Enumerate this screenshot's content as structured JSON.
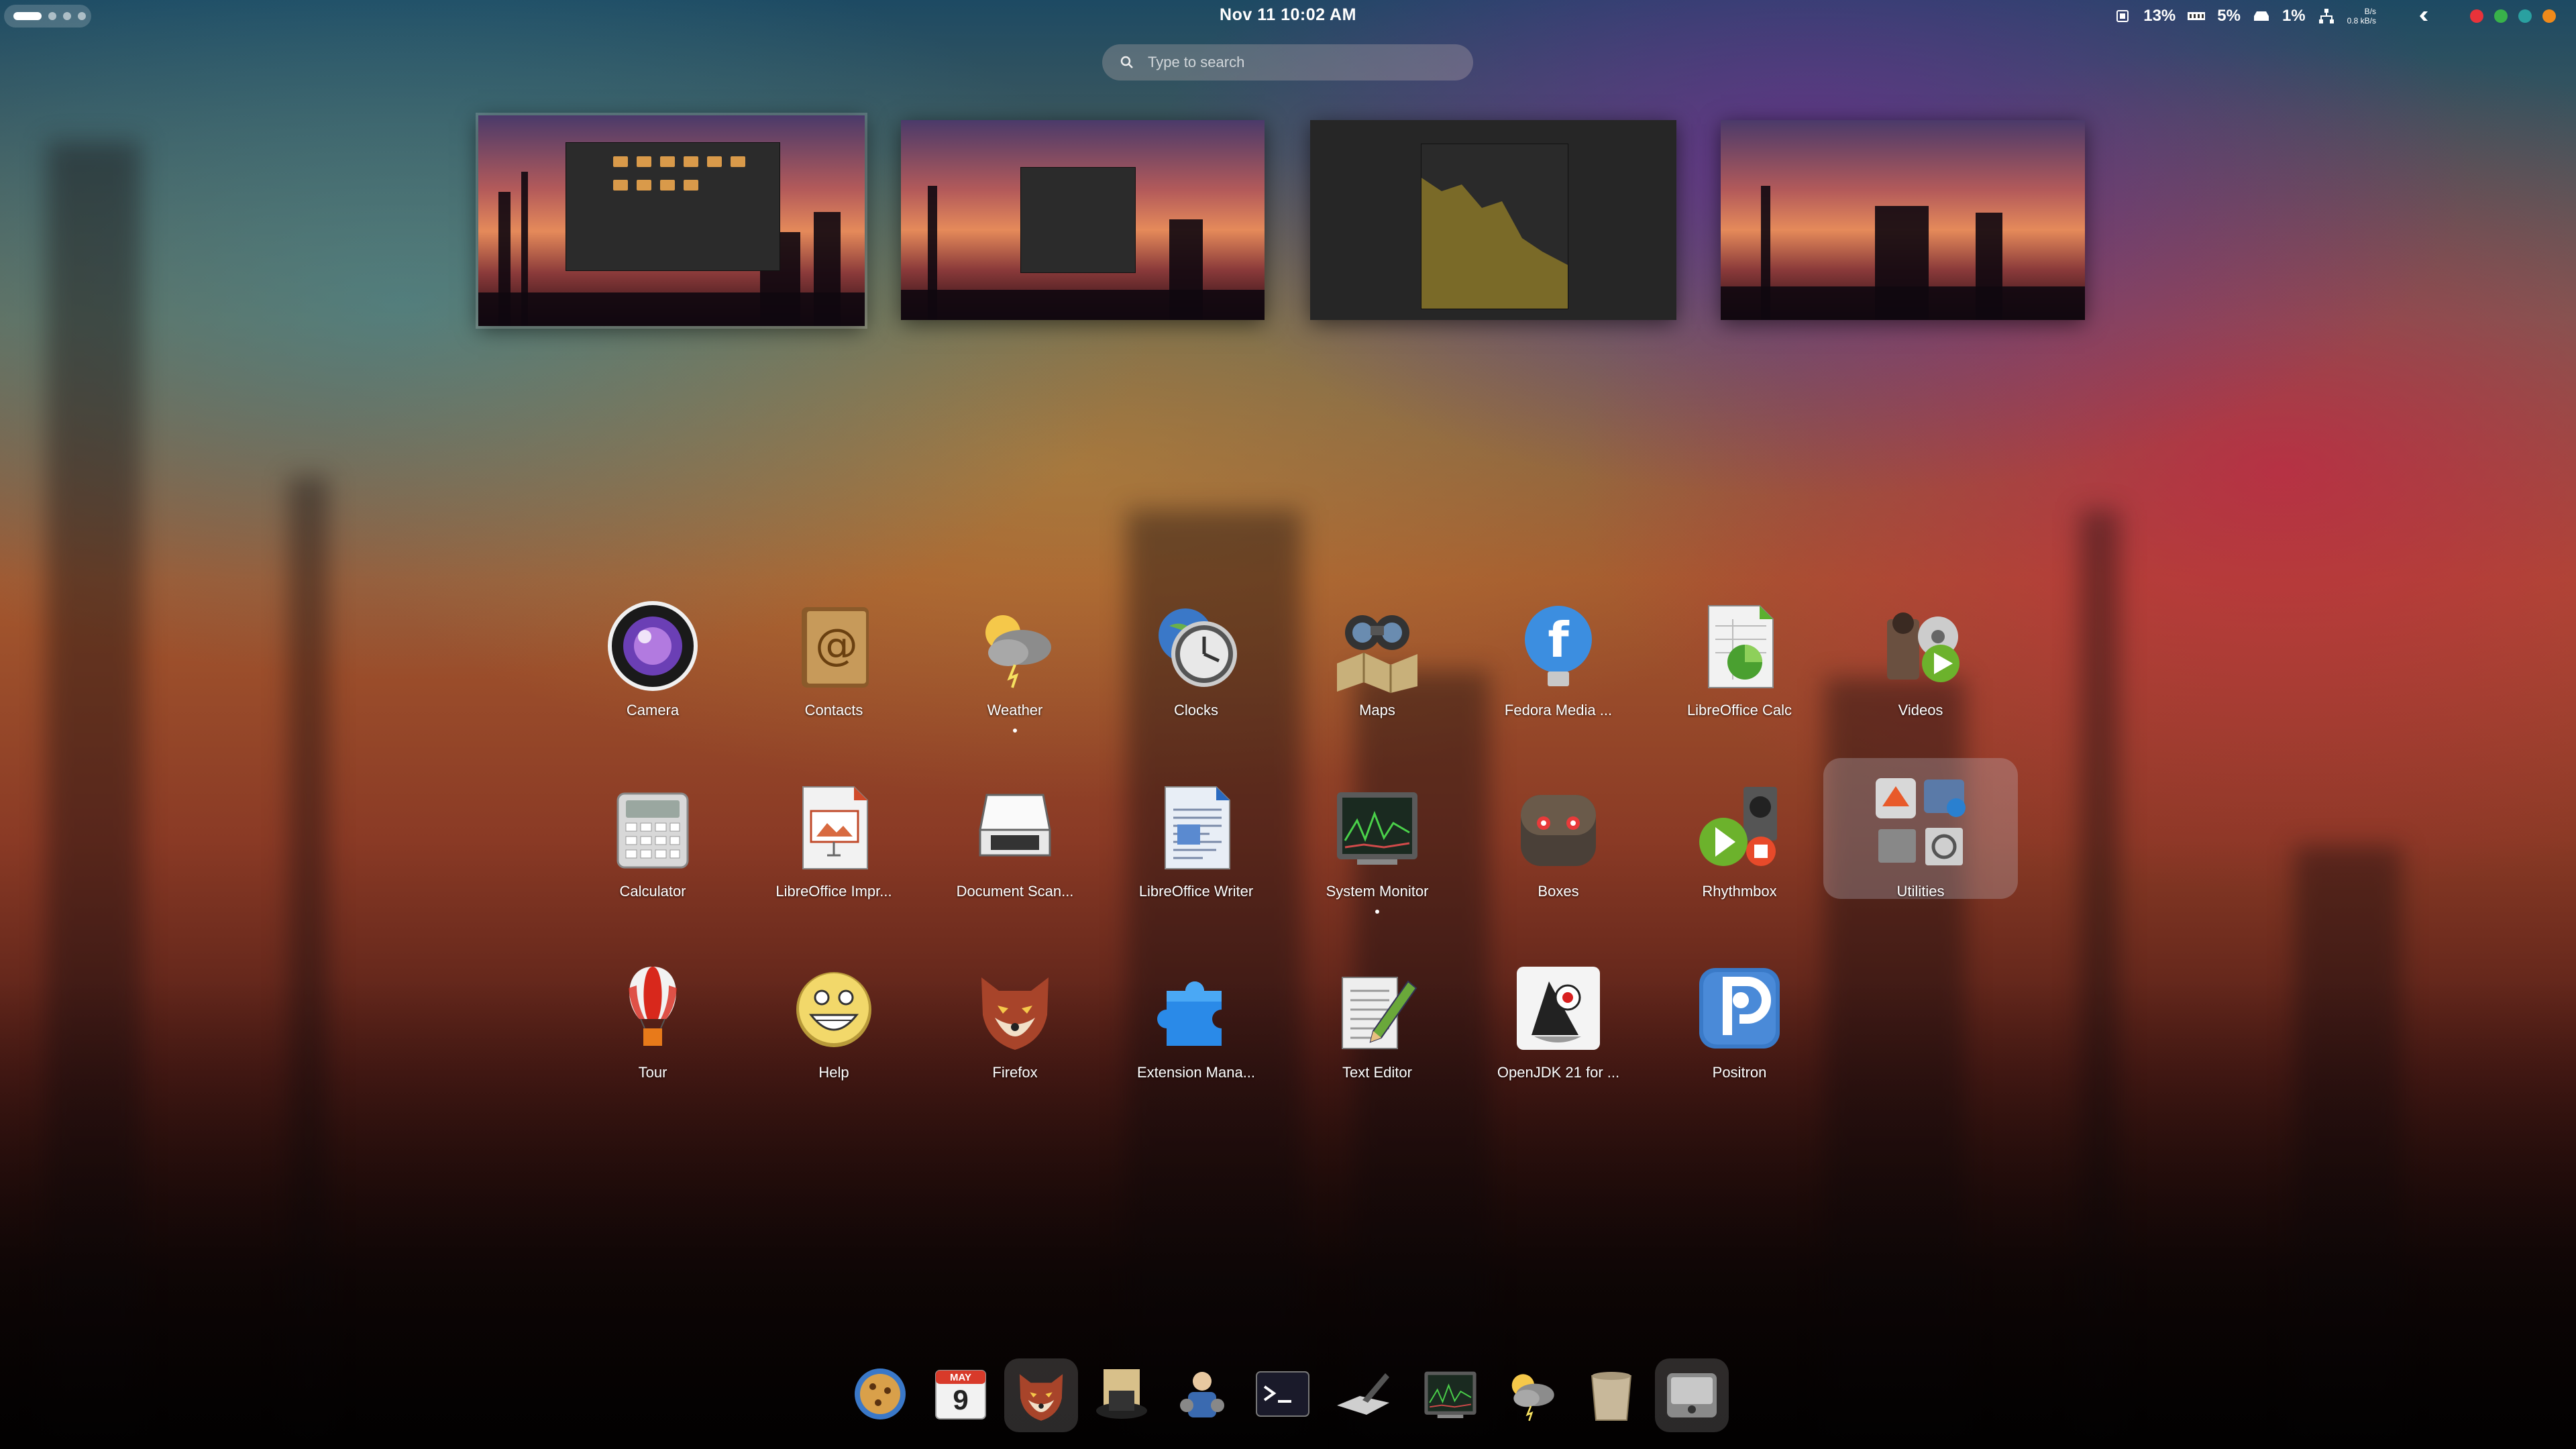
{
  "topbar": {
    "clock": "Nov 11  10:02 AM",
    "cpu": "13%",
    "memory": "5%",
    "disk": "1%",
    "net_up": "B/s",
    "net_down": "0.8 kB/s",
    "icons": [
      "cpu-icon",
      "memory-icon",
      "drive-icon",
      "network-icon",
      "system-icon",
      "red-app-icon",
      "green-app-icon",
      "teal-app-icon",
      "orange-app-icon"
    ]
  },
  "search": {
    "placeholder": "Type to search"
  },
  "workspaces": [
    {
      "content": "file-manager"
    },
    {
      "content": "settings-window"
    },
    {
      "content": "system-monitor-chart"
    },
    {
      "content": "empty"
    }
  ],
  "apps": [
    {
      "label": "Camera",
      "icon": "camera-icon"
    },
    {
      "label": "Contacts",
      "icon": "contacts-icon"
    },
    {
      "label": "Weather",
      "icon": "weather-icon",
      "running": true
    },
    {
      "label": "Clocks",
      "icon": "clocks-icon"
    },
    {
      "label": "Maps",
      "icon": "maps-icon"
    },
    {
      "label": "Fedora Media ...",
      "icon": "fedora-media-writer-icon"
    },
    {
      "label": "LibreOffice Calc",
      "icon": "libreoffice-calc-icon"
    },
    {
      "label": "Videos",
      "icon": "videos-icon"
    },
    {
      "label": "Calculator",
      "icon": "calculator-icon"
    },
    {
      "label": "LibreOffice Impr...",
      "icon": "libreoffice-impress-icon"
    },
    {
      "label": "Document Scan...",
      "icon": "document-scanner-icon"
    },
    {
      "label": "LibreOffice Writer",
      "icon": "libreoffice-writer-icon"
    },
    {
      "label": "System Monitor",
      "icon": "system-monitor-icon",
      "running": true
    },
    {
      "label": "Boxes",
      "icon": "boxes-icon"
    },
    {
      "label": "Rhythmbox",
      "icon": "rhythmbox-icon"
    },
    {
      "label": "Utilities",
      "icon": "utilities-folder-icon"
    },
    {
      "label": "Tour",
      "icon": "tour-icon"
    },
    {
      "label": "Help",
      "icon": "help-icon"
    },
    {
      "label": "Firefox",
      "icon": "firefox-icon"
    },
    {
      "label": "Extension Mana...",
      "icon": "extension-manager-icon"
    },
    {
      "label": "Text Editor",
      "icon": "text-editor-icon"
    },
    {
      "label": "OpenJDK 21 for ...",
      "icon": "openjdk-icon"
    },
    {
      "label": "Positron",
      "icon": "positron-icon"
    }
  ],
  "dock": [
    "cookie-browser-icon",
    "calendar-icon",
    "firefox-icon",
    "notes-hat-icon",
    "settings-person-icon",
    "terminal-icon",
    "disk-utility-icon",
    "system-monitor-icon",
    "weather-icon",
    "trash-icon",
    "app-grid-icon"
  ],
  "calendar": {
    "month": "MAY",
    "day": "9"
  }
}
